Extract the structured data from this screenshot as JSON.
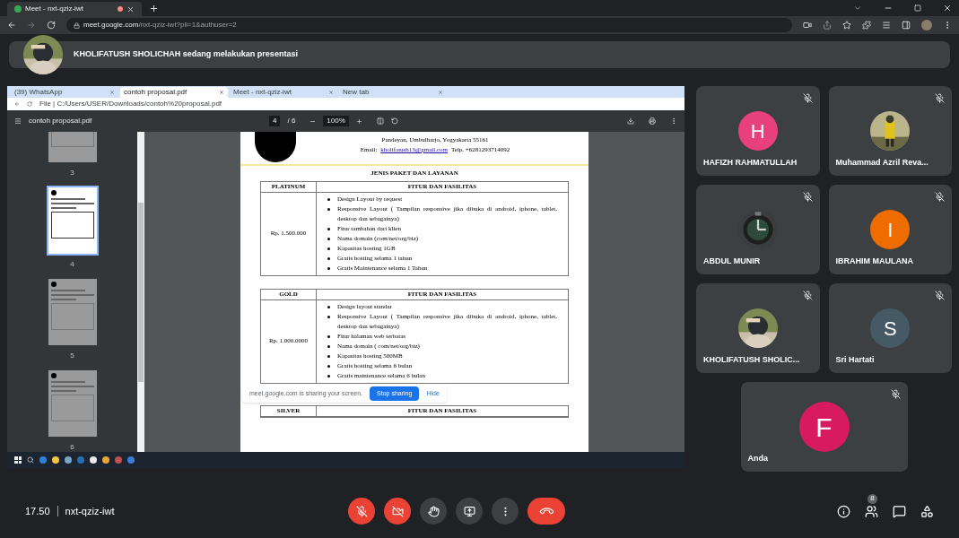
{
  "browser": {
    "tab_title": "Meet - nxt-qziz-iwt",
    "url_host": "meet.google.com",
    "url_path": "/nxt-qziz-iwt?pli=1&authuser=2"
  },
  "presenting_banner": "KHOLIFATUSH SHOLICHAH sedang melakukan presentasi",
  "shared_screen": {
    "tabs": [
      {
        "label": "(39) WhatsApp",
        "selected": false
      },
      {
        "label": "contoh proposal.pdf",
        "selected": true
      },
      {
        "label": "Meet - nxt-qziz-iwt",
        "selected": false
      },
      {
        "label": "New tab",
        "selected": false
      }
    ],
    "url": "File | C:/Users/USER/Downloads/contoh%20proposal.pdf",
    "pdf_title": "contoh proposal.pdf",
    "page": "4",
    "page_total": "/ 6",
    "zoom": "100%",
    "thumbnails": [
      {
        "label": "3",
        "selected": false
      },
      {
        "label": "4",
        "selected": true
      },
      {
        "label": "5",
        "selected": false
      },
      {
        "label": "6",
        "selected": false
      }
    ],
    "document": {
      "address_lines": [
        "Pandeyan, Umbulharjo, Yogyakarta 55161"
      ],
      "email_label": "Email:",
      "email": "kholifatush13@gmail.com",
      "phone": "Telp. +6281293714092",
      "title": "JENIS PAKET DAN LAYANAN",
      "packages": [
        {
          "name": "PLATINUM",
          "features_heading": "FITUR DAN FASILITAS",
          "price": "Rp. 1.500.000",
          "features": [
            "Design Layout by request",
            "Responsive Layout ( Tampilan responsive jika dibuka di android, iphone, tablet, desktop dan sebagainya)",
            "Fitur tambahan dari klien",
            "Nama domain (com/net/org/biz)",
            "Kapasitas hosting 1GB",
            "Gratis hosting selama 1 tahun",
            "Gratis Maintenance selama 1 Tahun"
          ]
        },
        {
          "name": "GOLD",
          "features_heading": "FITUR DAN FASILITAS",
          "price": "Rp. 1.000.0000",
          "features": [
            "Design layout standar",
            "Responsive Layout ( Tampilan responsive jika dibuka di android, iphone, tablet, desktop dan sebagainya)",
            "Fitur halaman web terbatas",
            "Nama domain ( com/net/org/biz)",
            "Kapasitas hosting 500MB",
            "Gratis hosting selama 6 bulan",
            "Gratis maintenance selama 6 bulan"
          ]
        },
        {
          "name": "SILVER",
          "features_heading": "FITUR DAN FASILITAS"
        }
      ]
    },
    "sharing_bar": {
      "message": "meet.google.com is sharing your screen.",
      "stop": "Stop sharing",
      "hide": "Hide"
    }
  },
  "participants": [
    {
      "name": "HAFIZH RAHMATULLAH",
      "kind": "initial",
      "initial": "H",
      "color": "#e8407a",
      "muted": true
    },
    {
      "name": "Muhammad Azril Reva...",
      "muted": true
    },
    {
      "name": "ABDUL MUNIR",
      "muted": true
    },
    {
      "name": "IBRAHIM MAULANA",
      "kind": "initial",
      "initial": "I",
      "color": "#ef6c00",
      "muted": true
    },
    {
      "name": "KHOLIFATUSH SHOLIC...",
      "muted": true
    },
    {
      "name": "Sri Hartati",
      "kind": "initial",
      "initial": "S",
      "color": "#455a64",
      "muted": true
    },
    {
      "name": "Anda",
      "kind": "initial",
      "initial": "F",
      "color": "#d81b60",
      "muted": true
    }
  ],
  "meeting": {
    "time": "17.50",
    "code": "nxt-qziz-iwt",
    "participant_count": "8",
    "mic_on": false,
    "camera_on": false
  }
}
